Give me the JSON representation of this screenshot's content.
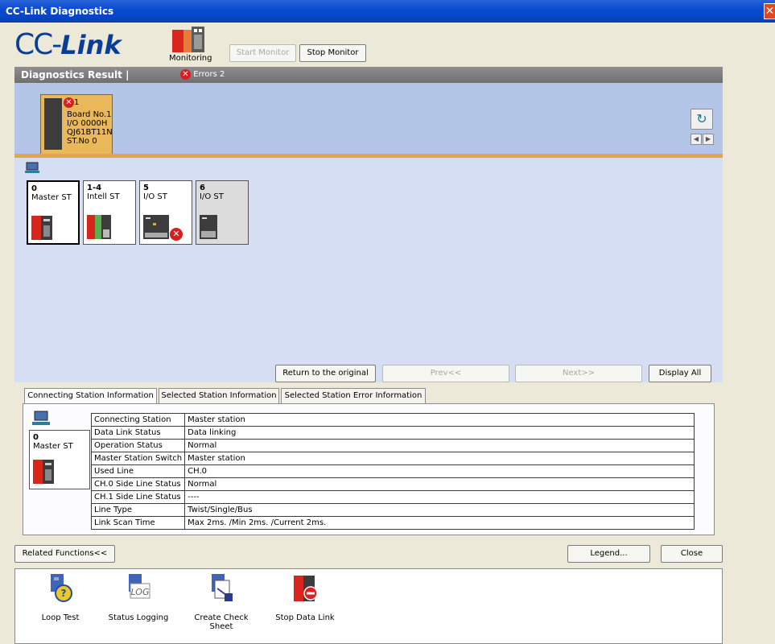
{
  "window": {
    "title": "CC-Link Diagnostics",
    "close_glyph": "✕"
  },
  "toolbar": {
    "logo_cc": "CC-",
    "logo_link": "Link",
    "monitoring_label": "Monitoring",
    "start_monitor": "Start Monitor",
    "stop_monitor": "Stop Monitor"
  },
  "diagnostics": {
    "header": "Diagnostics Result |",
    "errors_label": "Errors 2",
    "board": {
      "error_count": "1",
      "lines": [
        "Board No.1",
        "I/O 0000H",
        "QJ61BT11N",
        "ST.No 0"
      ]
    },
    "stations": [
      {
        "num": "0",
        "label": "Master ST",
        "selected": true,
        "error": false
      },
      {
        "num": "1-4",
        "label": "Intell ST",
        "selected": false,
        "error": false
      },
      {
        "num": "5",
        "label": "I/O ST",
        "selected": false,
        "error": true
      },
      {
        "num": "6",
        "label": "I/O ST",
        "selected": false,
        "error": false
      }
    ],
    "buttons": {
      "return_original": "Return to the original",
      "prev": "Prev<<",
      "next": "Next>>",
      "display_all": "Display All"
    }
  },
  "tabs": [
    {
      "label": "Connecting Station Information",
      "active": true
    },
    {
      "label": "Selected Station Information",
      "active": false
    },
    {
      "label": "Selected Station Error Information",
      "active": false
    }
  ],
  "panel_station": {
    "num": "0",
    "label": "Master ST"
  },
  "info_rows": [
    {
      "key": "Connecting Station",
      "value": "Master station"
    },
    {
      "key": "Data Link Status",
      "value": "Data linking"
    },
    {
      "key": "Operation Status",
      "value": "Normal"
    },
    {
      "key": "Master Station Switch",
      "value": "Master station"
    },
    {
      "key": "Used Line",
      "value": "CH.0"
    },
    {
      "key": "CH.0 Side Line Status",
      "value": "Normal"
    },
    {
      "key": "CH.1 Side Line Status",
      "value": "----"
    },
    {
      "key": "Line Type",
      "value": "Twist/Single/Bus"
    },
    {
      "key": "Link Scan Time",
      "value": "Max 2ms. /Min 2ms. /Current 2ms."
    }
  ],
  "footer": {
    "related_functions": "Related Functions<<",
    "legend": "Legend...",
    "close": "Close"
  },
  "functions": [
    {
      "label": "Loop Test",
      "icon": "loop-test-icon"
    },
    {
      "label": "Status Logging",
      "icon": "log-icon"
    },
    {
      "label": "Create Check Sheet",
      "icon": "check-sheet-icon"
    },
    {
      "label": "Stop Data Link",
      "icon": "stop-data-link-icon"
    }
  ],
  "colors": {
    "title_bar": "#0a4bcf",
    "board_highlight": "#e8b85a",
    "map_background": "#d5def3",
    "error_red": "#d42020"
  }
}
